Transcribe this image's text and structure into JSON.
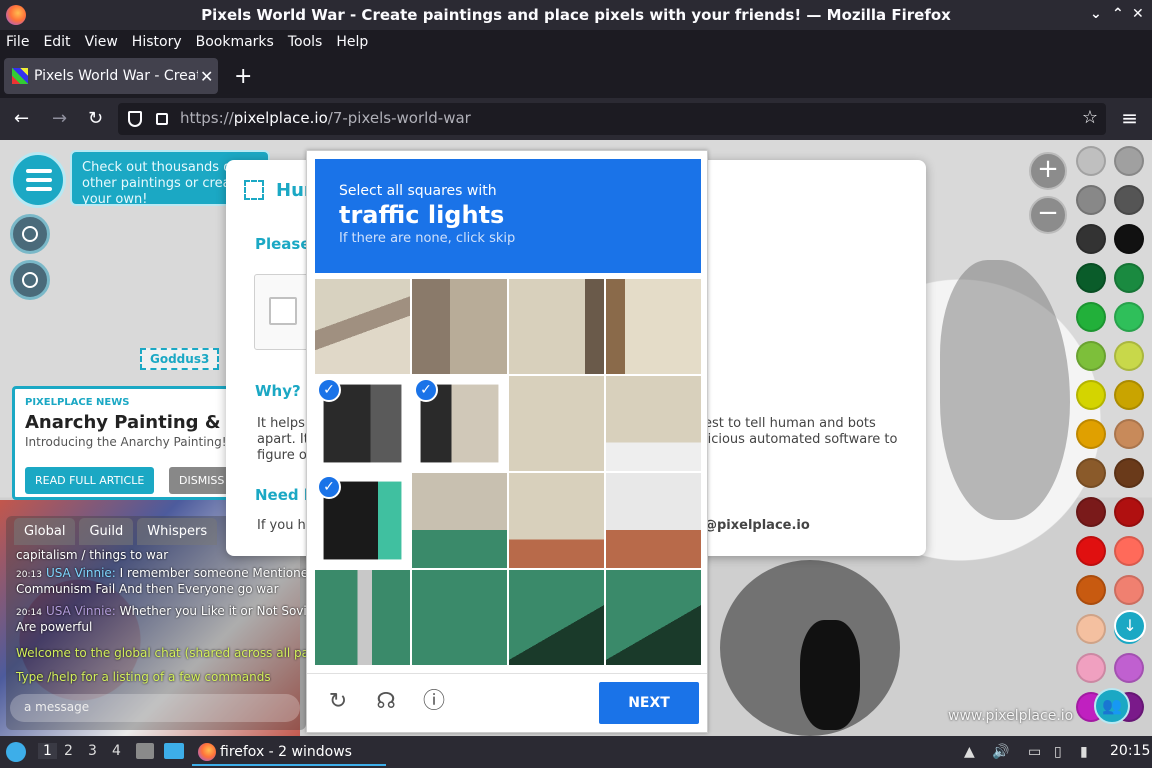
{
  "window": {
    "title": "Pixels World War - Create paintings and place pixels with your friends! — Mozilla Firefox",
    "controls": [
      "⌄",
      "⌃",
      "✕"
    ]
  },
  "menubar": [
    "File",
    "Edit",
    "View",
    "History",
    "Bookmarks",
    "Tools",
    "Help"
  ],
  "tab": {
    "title": "Pixels World War - Create paintings and place pixels with your friends!",
    "close": "✕",
    "new_tab": "+"
  },
  "nav": {
    "back": "←",
    "forward": "→",
    "reload": "↻",
    "url_prefix": "https://",
    "url_host": "pixelplace.io",
    "url_path": "/7-pixels-world-war",
    "bookmark": "☆",
    "menu": "≡"
  },
  "page": {
    "tooltip": "Check out thousands of other paintings or create your own!",
    "map_label": "Goddus3",
    "news": {
      "kicker": "PIXELPLACE NEWS",
      "headline": "Anarchy Painting & NSFW",
      "teaser": "Introducing the Anarchy Painting! Yes, ...",
      "read_label": "READ FULL ARTICLE",
      "dismiss_label": "DISMISS"
    },
    "chat": {
      "tabs": [
        "Global",
        "Guild",
        "Whispers"
      ],
      "line0": "capitalism / things to war",
      "msg1_time": "20:13",
      "msg1_user": "USA Vinnie:",
      "msg1_text": "I remember someone Mentioned",
      "msg1_cont": "Communism Fail And then Everyone go war",
      "msg2_time": "20:14",
      "msg2_user": "USA Vinnie:",
      "msg2_text": "Whether you Like it or Not Soviet",
      "msg2_cont": "Are powerful",
      "sys1": "Welcome to the global chat (shared across all paintings)",
      "sys2": "Type /help for a listing of a few commands",
      "input_placeholder": "a message"
    },
    "dialog": {
      "title": "Hum",
      "please": "Please",
      "why": "Why?",
      "help_a": "It helps apart. It figure ou",
      "help_b": "est to tell human and bots licious automated software to",
      "need_help": "Need h",
      "if_you": "If you ha",
      "email": "@pixelplace.io"
    },
    "captcha": {
      "instruction": "Select all squares with",
      "target": "traffic lights",
      "hint": "If there are none, click skip",
      "check": "✓",
      "reload_icon": "↻",
      "audio_icon": "☊",
      "info_icon": "ⓘ",
      "next_label": "NEXT",
      "cells_selected": [
        4,
        5,
        8
      ]
    },
    "zoom_in": "+",
    "zoom_out": "−",
    "download_icon": "↓",
    "users_icon": "👥",
    "watermark": "www.pixelplace.io",
    "palette": [
      "#bfbfbf",
      "#a0a0a0",
      "#888888",
      "#555555",
      "#333333",
      "#111111",
      "#0a5c2a",
      "#1a8a40",
      "#22b03a",
      "#2fbf5a",
      "#7dbf3a",
      "#c8d84a",
      "#d4d400",
      "#c9a400",
      "#e0a000",
      "#c88a5a",
      "#8a5a2a",
      "#6a3a1a",
      "#7a1a1a",
      "#b01010",
      "#e01010",
      "#ff6a5a",
      "#c85a10",
      "#f08070",
      "#f4c0a0",
      "#1ba8c4",
      "#f0a0c0",
      "#c060d0",
      "#c020c0",
      "#7a1a8a"
    ]
  },
  "taskbar": {
    "workspaces": [
      "1",
      "2",
      "3",
      "4"
    ],
    "firefox_label": "firefox - 2 windows",
    "clock": "20:15"
  }
}
